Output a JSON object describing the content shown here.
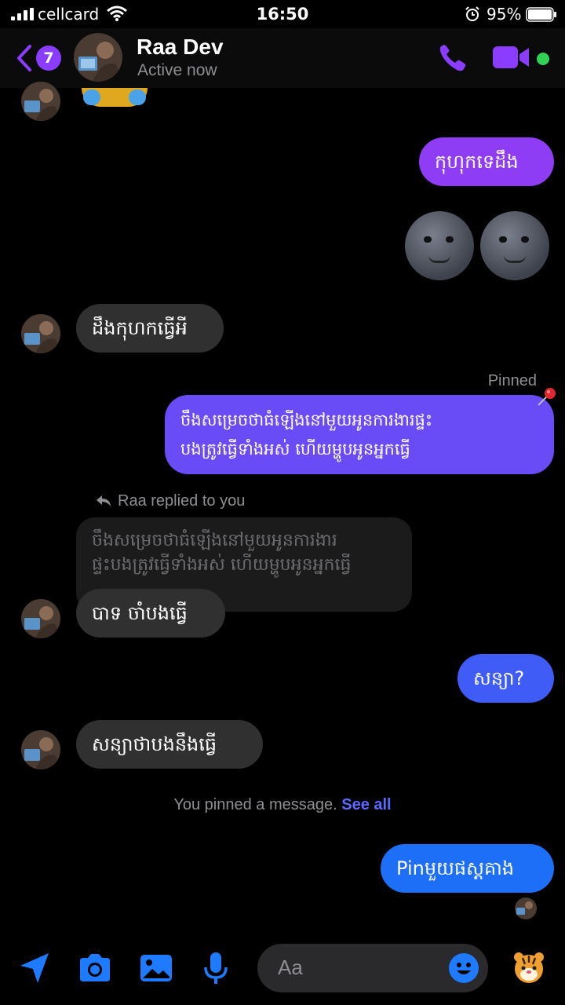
{
  "status_bar": {
    "carrier": "cellcard",
    "time": "16:50",
    "battery": "95%"
  },
  "header": {
    "back_badge": "7",
    "contact_name": "Raa Dev",
    "contact_status": "Active now"
  },
  "messages": {
    "out_1": "កុហុកទេដឹង",
    "in_1": "ដឹងកុហកធ្វើអី",
    "pinned_label": "Pinned",
    "out_pinned_line1": "ចឹងសម្រេចថាធំឡើងនៅមួយអូនការងារផ្ទះ",
    "out_pinned_line2": "បងត្រូវធ្វើទាំងអស់ ហើយម្ហូបអូនអ្នកធ្វើ",
    "reply_label": "Raa replied to you",
    "quoted_line1": "ចឹងសម្រេចថាធំឡើងនៅមួយអូនការងារ",
    "quoted_line2": "ផ្ទះបងត្រូវធ្វើទាំងអស់ ហើយម្ហូបអូនអ្នកធ្វើ",
    "in_2": "បាទ ចាំបងធ្វើ",
    "out_2": "សន្យា?",
    "in_3": "សន្យាថាបងនឹងធ្វើ",
    "system_note": "You pinned a message.",
    "see_all": "See all",
    "out_3": "Pinមួយផស្តគាង"
  },
  "composer": {
    "placeholder": "Aa"
  },
  "colors": {
    "purple": "#8b3dff",
    "violet": "#6b4cf6",
    "blue": "#1e7bff",
    "incoming": "#303030"
  },
  "icons": [
    "signal-icon",
    "wifi-icon",
    "alarm-icon",
    "battery-icon",
    "back-chevron-icon",
    "phone-icon",
    "video-camera-icon",
    "pin-icon",
    "reply-arrow-icon",
    "send-location-icon",
    "camera-icon",
    "gallery-icon",
    "microphone-icon",
    "emoji-icon",
    "tiger-sticker-icon"
  ]
}
